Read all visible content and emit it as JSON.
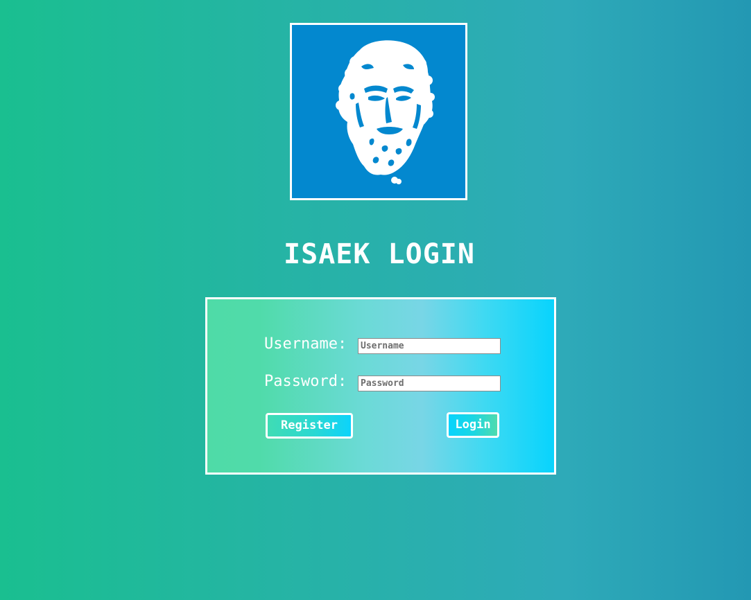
{
  "header": {
    "logo": {
      "icon": "bearded-philosopher-head-icon",
      "background_color": "#0388cf"
    },
    "title": "ISAEK LOGIN"
  },
  "login_form": {
    "username": {
      "label": "Username:",
      "placeholder": "Username",
      "value": ""
    },
    "password": {
      "label": "Password:",
      "placeholder": "Password",
      "value": ""
    },
    "register_button": "Register",
    "login_button": "Login"
  },
  "colors": {
    "page_gradient_start": "#1abf90",
    "page_gradient_end": "#2398b3",
    "accent_cyan": "#08d4fd",
    "accent_green": "#4fdba7",
    "border": "#ffffff"
  }
}
